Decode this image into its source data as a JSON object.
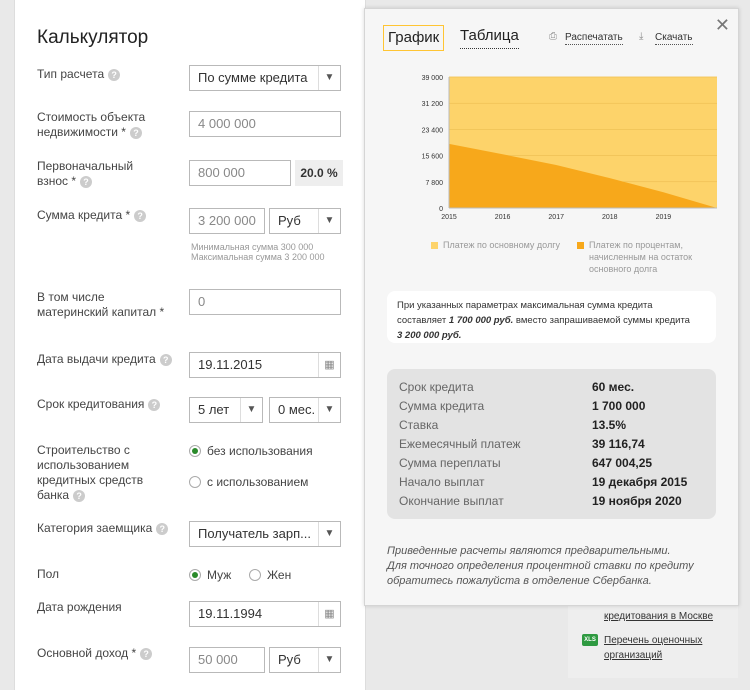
{
  "calculator": {
    "title": "Калькулятор",
    "calc_type": {
      "label": "Тип расчета",
      "value": "По сумме кредита"
    },
    "property_cost": {
      "label_l1": "Стоимость объекта",
      "label_l2": "недвижимости *",
      "value": "4 000 000"
    },
    "down_payment": {
      "label_l1": "Первоначальный",
      "label_l2": "взнос *",
      "value": "800 000",
      "percent": "20.0 %"
    },
    "loan_amount": {
      "label": "Сумма кредита *",
      "value": "3 200 000",
      "currency": "Руб",
      "hint_l1": "Минимальная сумма 300 000",
      "hint_l2": "Максимальная сумма 3 200 000"
    },
    "maternity_capital": {
      "label_l1": "В том числе",
      "label_l2": "материнский капитал *",
      "value": "0"
    },
    "issue_date": {
      "label": "Дата выдачи кредита",
      "value": "19.11.2015"
    },
    "term": {
      "label": "Срок кредитования",
      "years": "5 лет",
      "months": "0 мес."
    },
    "construction": {
      "label_l1": "Строительство с",
      "label_l2": "использованием",
      "label_l3": "кредитных средств",
      "label_l4": "банка",
      "opt_without": "без использования",
      "opt_with": "с использованием",
      "selected": "без использования"
    },
    "borrower_category": {
      "label": "Категория заемщика",
      "value": "Получатель зарп..."
    },
    "gender": {
      "label": "Пол",
      "male": "Муж",
      "female": "Жен",
      "selected": "Муж"
    },
    "birth_date": {
      "label": "Дата рождения",
      "value": "19.11.1994"
    },
    "income": {
      "label": "Основной доход *",
      "value": "50 000",
      "currency": "Руб"
    }
  },
  "results": {
    "tabs": {
      "chart": "График",
      "table": "Таблица"
    },
    "print_label": "Распечатать",
    "download_label": "Скачать",
    "close_label": "✕",
    "legend_principal": "Платеж по основному долгу",
    "legend_interest_l1": "Платеж по процентам,",
    "legend_interest_l2": "начисленным на остаток",
    "legend_interest_l3": "основного долга",
    "note_l1": "При указанных параметрах максимальная сумма кредита",
    "note_l2_pre": "составляет ",
    "note_l2_amount": "1 700 000 руб.",
    "note_l2_post": " вместо запрашиваемой суммы кредита",
    "note_l3": "3 200 000 руб.",
    "summary": [
      {
        "k": "Срок кредита",
        "v": "60 мес."
      },
      {
        "k": "Сумма кредита",
        "v": "1 700 000"
      },
      {
        "k": "Ставка",
        "v": "13.5%"
      },
      {
        "k": "Ежемесячный платеж",
        "v": "39 116,74"
      },
      {
        "k": "Сумма переплаты",
        "v": "647 004,25"
      },
      {
        "k": "Начало выплат",
        "v": "19 декабря 2015"
      },
      {
        "k": "Окончание выплат",
        "v": "19 ноября 2020"
      }
    ],
    "disclaimer_l1": "Приведенные расчеты являются предварительными.",
    "disclaimer_l2": "Для точного определения процентной ставки по кредиту",
    "disclaimer_l3": "обратитесь пожалуйста в отделение Сбербанка."
  },
  "side_links": {
    "link1": "кредитования в Москве",
    "link2_l1": "Перечень оценочных",
    "link2_l2": "организаций",
    "xls_icon": "XLS"
  },
  "chart_data": {
    "type": "area",
    "x": [
      "2015",
      "2016",
      "2017",
      "2018",
      "2019"
    ],
    "y_ticks": [
      "39 000",
      "31 200",
      "23 400",
      "15 600",
      "7 800",
      "0"
    ],
    "ylim": [
      0,
      39000
    ],
    "xlim": [
      2015,
      2020
    ],
    "series": [
      {
        "name": "Платеж по основному долгу",
        "color": "#fdd36a",
        "points": [
          [
            2015,
            39117
          ],
          [
            2020,
            39117
          ]
        ]
      },
      {
        "name": "Платеж по процентам, начисленным на остаток основного долга",
        "color": "#f7a81b",
        "points": [
          [
            2015,
            19100
          ],
          [
            2016,
            16000
          ],
          [
            2017,
            12800
          ],
          [
            2018,
            8900
          ],
          [
            2019,
            4700
          ],
          [
            2020,
            0
          ]
        ]
      }
    ]
  },
  "colors": {
    "accent_tab_border": "#ffc533",
    "principal": "#fdd36a",
    "interest": "#f7a81b",
    "radio_on": "#2a8a2a"
  }
}
